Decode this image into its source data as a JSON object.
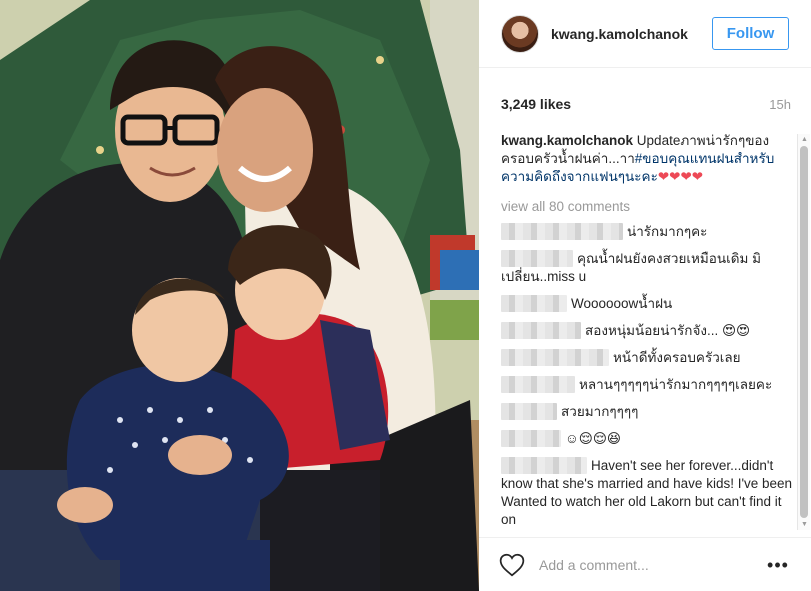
{
  "post": {
    "username": "kwang.kamolchanok",
    "follow_label": "Follow",
    "likes": "3,249 likes",
    "time": "15h",
    "caption": {
      "username": "kwang.kamolchanok",
      "text": " Updateภาพน่ารักๆของครอบครัวน้ำฝนค่า...าา",
      "hashtag": "#ขอบคุณแทนฝนสำหรับความคิดถึงจากแฟนๆนะคะ",
      "hearts": "❤❤❤❤"
    },
    "view_all": "view all 80 comments",
    "comments": [
      {
        "text": "น่ารักมากๆคะ"
      },
      {
        "text": "คุณน้ำฝนยังคงสวยเหมือนเดิม มิเปลี่ยน..miss u"
      },
      {
        "text": "Woooooowน้ำฝน"
      },
      {
        "text": "สองหนุ่มน้อยน่ารักจัง... 😍😍"
      },
      {
        "text": "หน้าดีทั้งครอบครัวเลย"
      },
      {
        "text": "หลานๆๆๆๆๆน่ารักมากๆๆๆๆเลยคะ"
      },
      {
        "text": "สวยมากๆๆๆๆ"
      },
      {
        "text": "☺😌😌😆"
      },
      {
        "text": "Haven't see her forever...didn't know that she's married and have kids! I've been Wanted to watch her old Lakorn but can't find it on"
      }
    ],
    "comment_placeholder": "Add a comment...",
    "more_label": "•••"
  },
  "colors": {
    "accent": "#3897f0",
    "hashtag": "#003569",
    "heart": "#ed4956",
    "muted": "#999999"
  },
  "icons": {
    "like": "heart-outline-icon",
    "more": "ellipsis-icon"
  }
}
